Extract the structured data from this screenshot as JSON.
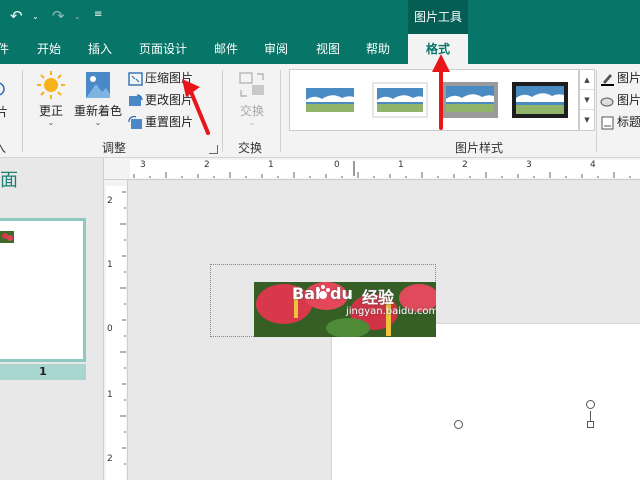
{
  "quick_access": {
    "undo_icon": "undo-icon",
    "redo_icon": "redo-icon",
    "customize_icon": "customize-qat-icon"
  },
  "contextual_tab_group": "图片工具",
  "tabs": [
    {
      "label": "件",
      "active": false
    },
    {
      "label": "开始",
      "active": false
    },
    {
      "label": "插入",
      "active": false
    },
    {
      "label": "页面设计",
      "active": false
    },
    {
      "label": "邮件",
      "active": false
    },
    {
      "label": "审阅",
      "active": false
    },
    {
      "label": "视图",
      "active": false
    },
    {
      "label": "帮助",
      "active": false
    },
    {
      "label": "格式",
      "active": true
    }
  ],
  "ribbon": {
    "adjust_group": {
      "label": "调整",
      "partial_left_label": "片",
      "partial_left_group_label": "入",
      "corrections": "更正",
      "recolor": "重新着色",
      "compress": "压缩图片",
      "change": "更改图片",
      "reset": "重置图片"
    },
    "swap_group": {
      "label": "交换",
      "swap": "交换"
    },
    "styles_group": {
      "label": "图片样式"
    },
    "right_partial": {
      "item1": "图片",
      "item2": "图片",
      "item3": "标题"
    }
  },
  "left_pane": {
    "title": "面",
    "slide_number": "1"
  },
  "rulers": {
    "horizontal": [
      "3",
      "2",
      "1",
      "0",
      "1",
      "2",
      "3",
      "4"
    ],
    "vertical": [
      "2",
      "1",
      "0",
      "1",
      "2"
    ]
  },
  "watermark": {
    "main": "Bai",
    "du": "du",
    "jingyan": "经验",
    "url": "jingyan.baidu.com"
  },
  "colors": {
    "accent": "#077568",
    "arrow": "#e8161b",
    "tab_active_text": "#077568"
  }
}
